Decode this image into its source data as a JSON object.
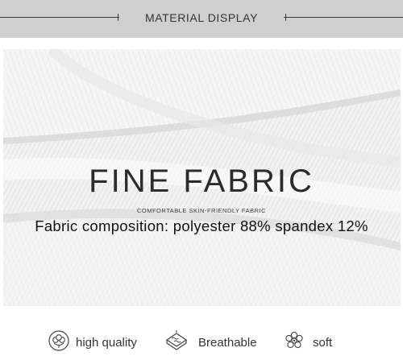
{
  "banner": {
    "title": "MATERIAL DISPLAY"
  },
  "hero": {
    "headline": "FINE FABRIC",
    "subheadline": "COMFORTABLE SKIN-FRIENDLY FABRIC",
    "composition": "Fabric composition: polyester 88% spandex 12%"
  },
  "features": [
    {
      "icon": "cotton-boll-icon",
      "label": "high quality"
    },
    {
      "icon": "breathable-fabric-icon",
      "label": "Breathable"
    },
    {
      "icon": "soft-flower-icon",
      "label": "soft"
    }
  ]
}
